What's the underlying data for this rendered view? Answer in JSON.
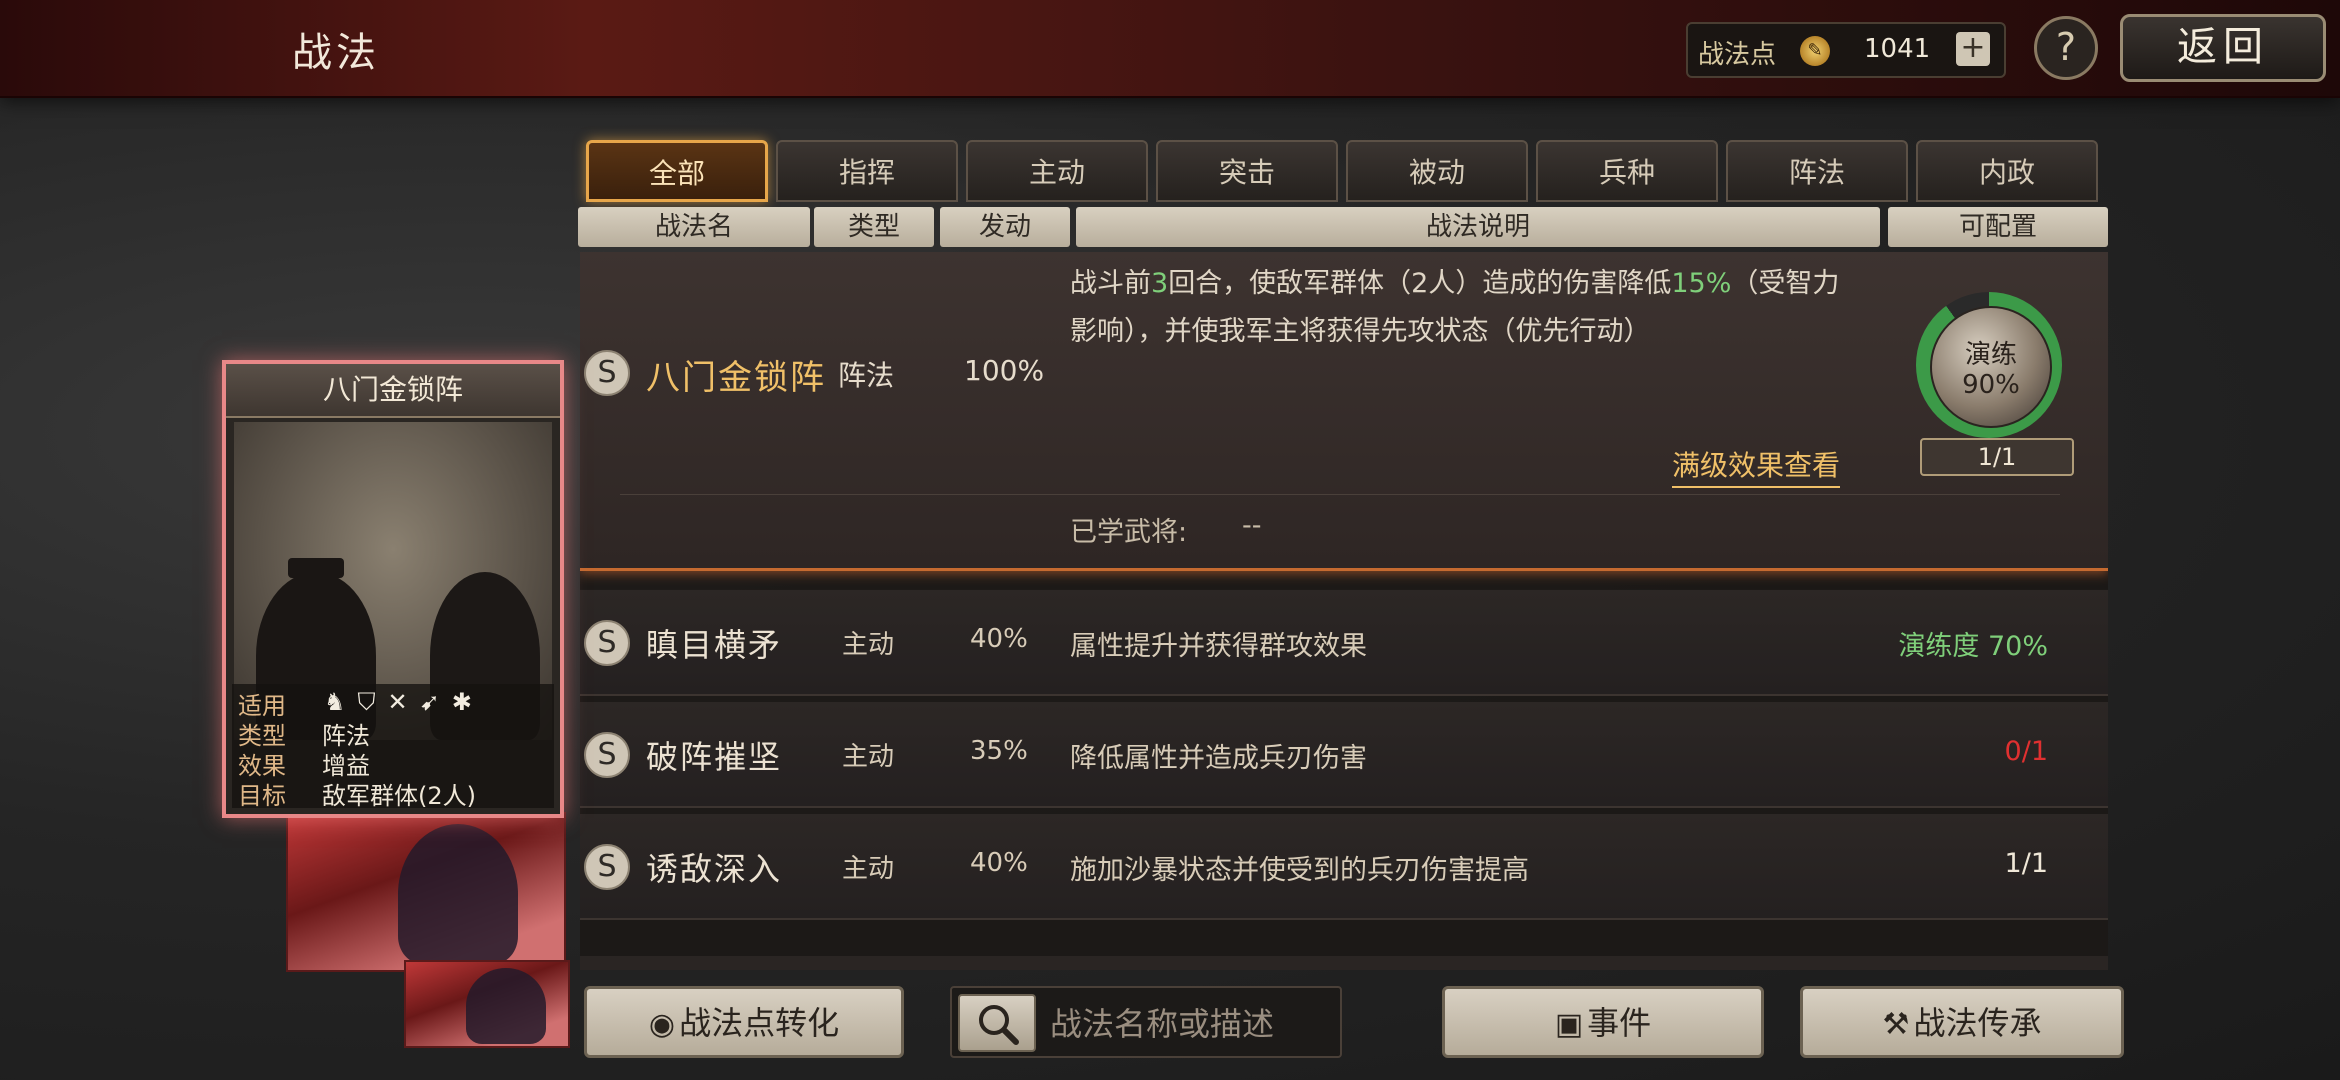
{
  "header": {
    "title": "战法",
    "points_label": "战法点",
    "points_value": "1041",
    "plus_label": "+",
    "help_label": "?",
    "back_label": "返回"
  },
  "tabs": [
    {
      "label": "全部",
      "active": true
    },
    {
      "label": "指挥",
      "active": false
    },
    {
      "label": "主动",
      "active": false
    },
    {
      "label": "突击",
      "active": false
    },
    {
      "label": "被动",
      "active": false
    },
    {
      "label": "兵种",
      "active": false
    },
    {
      "label": "阵法",
      "active": false
    },
    {
      "label": "内政",
      "active": false
    }
  ],
  "columns": {
    "name": "战法名",
    "type": "类型",
    "trigger": "发动",
    "description": "战法说明",
    "configurable": "可配置"
  },
  "selected_tactic": {
    "badge": "S",
    "name": "八门金锁阵",
    "type": "阵法",
    "trigger": "100%",
    "desc_part1": "战斗前",
    "desc_num1": "3",
    "desc_part2": "回合，使敌军群体（2人）造成的伤害降低",
    "desc_num2": "15%",
    "desc_part3": "（受智力影响），并使我军主将获得先攻状态（优先行动）",
    "full_level_link": "满级效果查看",
    "learned_label": "已学武将:",
    "learned_value": "--",
    "drill_label": "演练",
    "drill_pct": "90%",
    "drill_count": "1/1",
    "drill_progress": 0.9
  },
  "rows": [
    {
      "badge": "S",
      "name": "瞋目横矛",
      "type": "主动",
      "trigger": "40%",
      "desc": "属性提升并获得群攻效果",
      "status": "演练度 70%",
      "status_color": "#7fcf7a"
    },
    {
      "badge": "S",
      "name": "破阵摧坚",
      "type": "主动",
      "trigger": "35%",
      "desc": "降低属性并造成兵刃伤害",
      "status": "0/1",
      "status_color": "#e03030"
    },
    {
      "badge": "S",
      "name": "诱敌深入",
      "type": "主动",
      "trigger": "40%",
      "desc": "施加沙暴状态并使受到的兵刃伤害提高",
      "status": "1/1",
      "status_color": "#f0e8d8"
    }
  ],
  "card": {
    "title": "八门金锁阵",
    "label_apply": "适用",
    "apply_icons": "♞⛉✕➹✱",
    "label_type": "类型",
    "value_type": "阵法",
    "label_effect": "效果",
    "value_effect": "增益",
    "label_target": "目标",
    "value_target": "敌军群体(2人)"
  },
  "bottom": {
    "convert_icon": "◉",
    "convert_label": "战法点转化",
    "search_placeholder": "战法名称或描述",
    "search_value": "",
    "event_icon": "▣",
    "event_label": "事件",
    "inherit_icon": "⚒",
    "inherit_label": "战法传承"
  },
  "colors": {
    "accent_gold": "#f0c068",
    "tab_active_border": "#e7a64a",
    "progress_green": "#3c9a48",
    "error_red": "#e03030"
  }
}
